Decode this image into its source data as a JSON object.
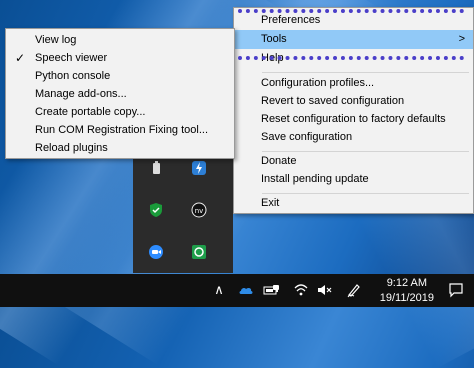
{
  "main_menu": {
    "items": [
      {
        "label": "Preferences",
        "has_submenu": true
      },
      {
        "label": "Tools",
        "has_submenu": true,
        "arrow": ">"
      },
      {
        "label": "Help",
        "has_submenu": true
      },
      {
        "label": "Configuration profiles..."
      },
      {
        "label": "Revert to saved configuration"
      },
      {
        "label": "Reset configuration to factory defaults"
      },
      {
        "label": "Save configuration"
      },
      {
        "label": "Donate"
      },
      {
        "label": "Install pending update"
      },
      {
        "label": "Exit"
      }
    ]
  },
  "tools_submenu": {
    "items": [
      {
        "label": "View log"
      },
      {
        "label": "Speech viewer",
        "checked": true,
        "check": "✓"
      },
      {
        "label": "Python console"
      },
      {
        "label": "Manage add-ons..."
      },
      {
        "label": "Create portable copy..."
      },
      {
        "label": "Run COM Registration Fixing tool..."
      },
      {
        "label": "Reload plugins"
      }
    ]
  },
  "taskbar": {
    "chevron": "∧",
    "time": "9:12 AM",
    "date": "19/11/2019"
  },
  "colors": {
    "menu_bg": "#f2f2f2",
    "highlight": "#91c9f7",
    "focus_dots": "#4b3fc9",
    "taskbar": "#101010"
  }
}
